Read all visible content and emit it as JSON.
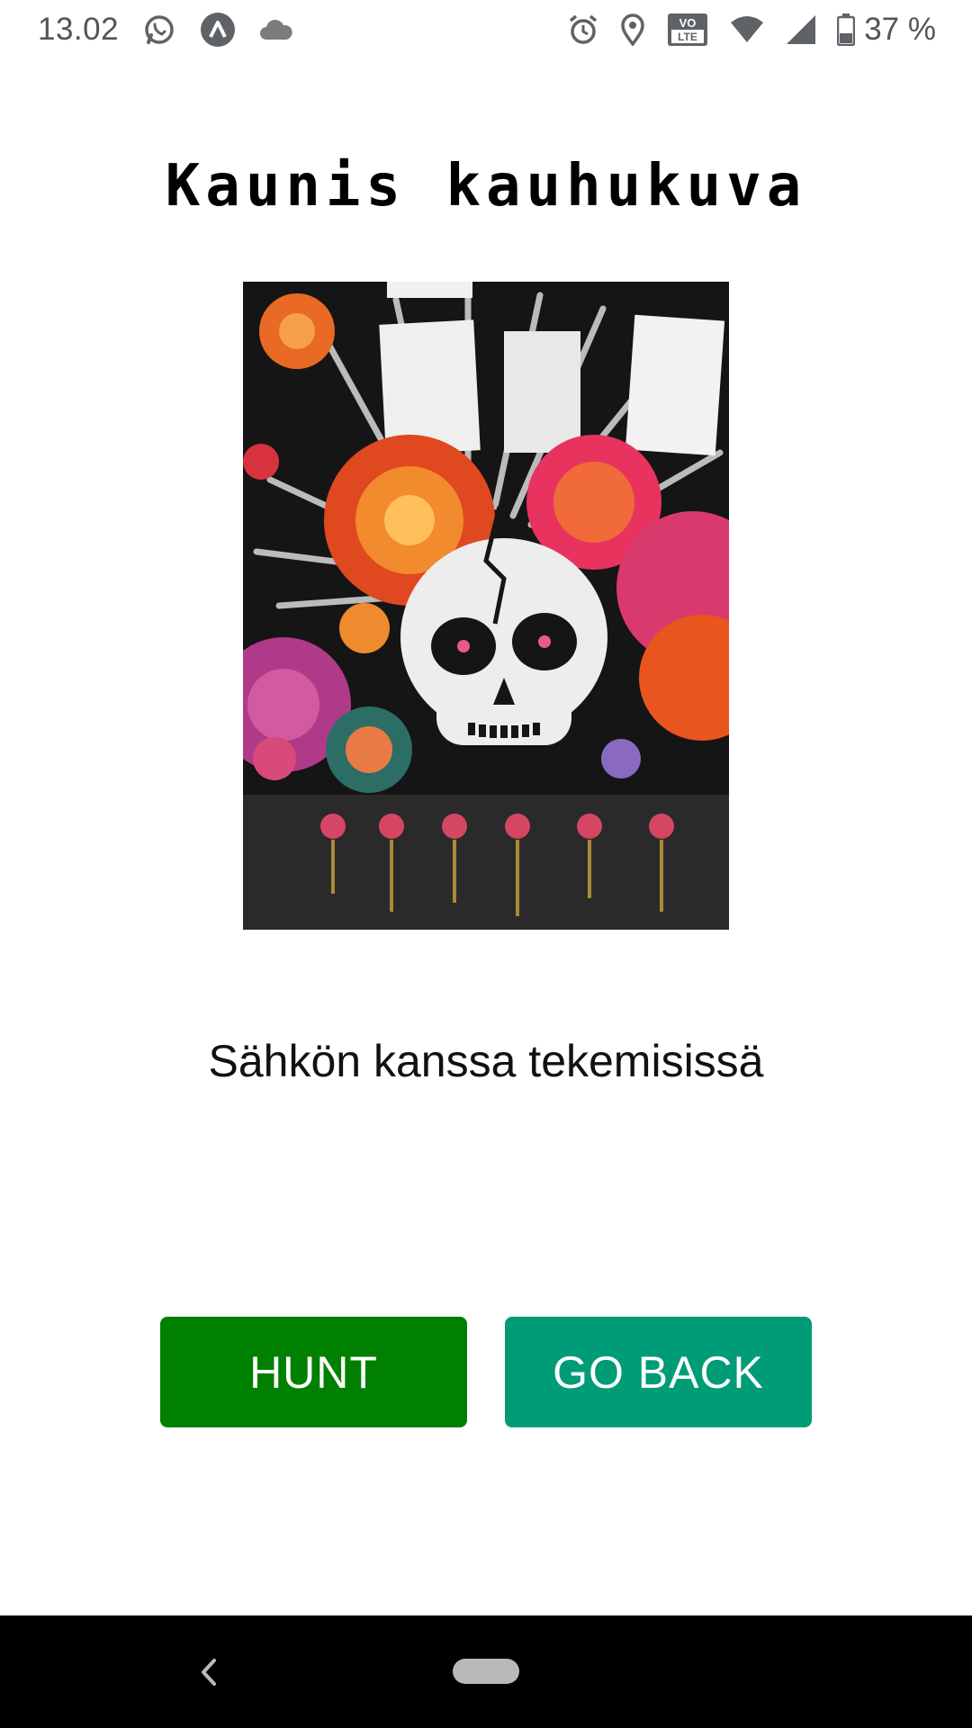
{
  "status_bar": {
    "time": "13.02",
    "icons_left": [
      "whatsapp-icon",
      "app-a-icon",
      "cloud-icon"
    ],
    "icons_right": [
      "alarm-icon",
      "location-icon",
      "volte-icon",
      "wifi-icon",
      "signal-icon",
      "battery-icon"
    ],
    "volte_label": "VO LTE",
    "battery_percent": "37 %"
  },
  "page": {
    "title": "Kaunis kauhukuva",
    "caption": "Sähkön kanssa tekemisissä"
  },
  "buttons": {
    "hunt_label": "HUNT",
    "hunt_color": "#008000",
    "go_back_label": "GO BACK",
    "go_back_color": "#009b77"
  },
  "nav_bar": {
    "icons": [
      "back-icon",
      "home-pill-icon"
    ]
  }
}
